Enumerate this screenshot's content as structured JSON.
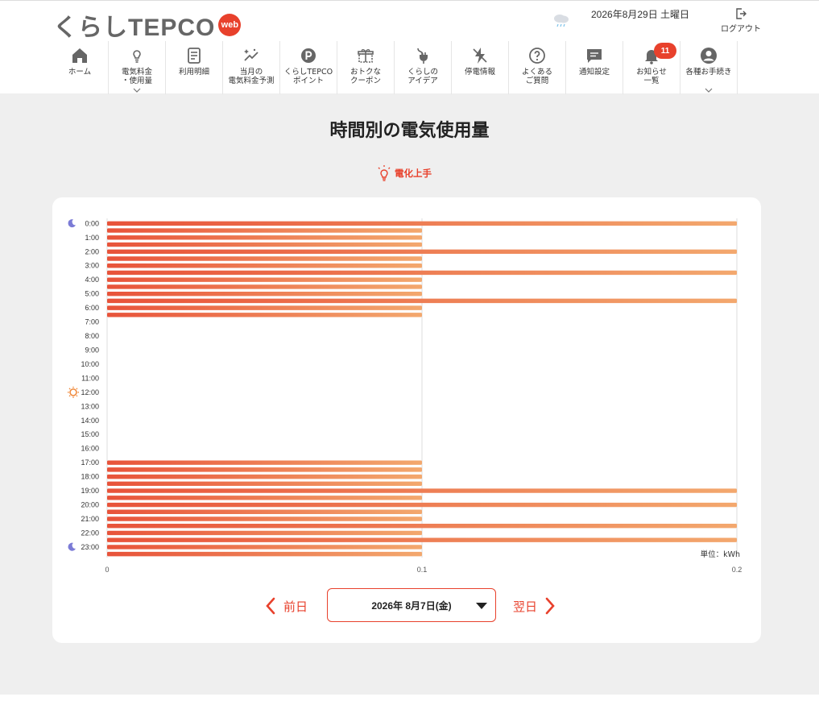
{
  "header": {
    "logo_main": "くらしTEPCO",
    "logo_badge": "web",
    "date": "2026年8月29日 土曜日",
    "logout_label": "ログアウト",
    "weather_icon": "cloud-rain-icon"
  },
  "nav": [
    {
      "id": "home",
      "label": "ホーム",
      "icon": "home-icon"
    },
    {
      "id": "usage",
      "label": "電気料金\n・使用量",
      "icon": "bulb-icon",
      "dropdown": true
    },
    {
      "id": "statement",
      "label": "利用明細",
      "icon": "document-icon"
    },
    {
      "id": "forecast",
      "label": "当月の\n電気料金予測",
      "icon": "sparkle-chart-icon"
    },
    {
      "id": "points",
      "label": "くらしTEPCO\nポイント",
      "icon": "point-icon"
    },
    {
      "id": "coupon",
      "label": "おトクな\nクーポン",
      "icon": "gift-icon"
    },
    {
      "id": "idea",
      "label": "くらしの\nアイデア",
      "icon": "plug-icon"
    },
    {
      "id": "outage",
      "label": "停電情報",
      "icon": "lightning-icon"
    },
    {
      "id": "faq",
      "label": "よくある\nご質問",
      "icon": "question-icon"
    },
    {
      "id": "notify-settings",
      "label": "通知設定",
      "icon": "chat-icon"
    },
    {
      "id": "notices",
      "label": "お知らせ\n一覧",
      "icon": "bell-icon",
      "badge": "11"
    },
    {
      "id": "procedures",
      "label": "各種お手続き",
      "icon": "user-icon",
      "dropdown": true
    }
  ],
  "main": {
    "title": "時間別の電気使用量",
    "denka_link": "電化上手"
  },
  "pager": {
    "prev_label": "前日",
    "next_label": "翌日",
    "selected_date": "2026年 8月7日(金)"
  },
  "colors": {
    "accent": "#e8412c",
    "bar_start": "#e8533a",
    "bar_end": "#f3a86e",
    "moon": "#7b7bd6",
    "sun": "#f08a3c"
  },
  "chart_data": {
    "type": "bar",
    "orientation": "horizontal",
    "unit_label": "単位：kWh",
    "xlim": [
      0,
      0.2
    ],
    "x_ticks": [
      "0",
      "0.1",
      "0.2"
    ],
    "hour_labels": [
      "0:00",
      "1:00",
      "2:00",
      "3:00",
      "4:00",
      "5:00",
      "6:00",
      "7:00",
      "8:00",
      "9:00",
      "10:00",
      "11:00",
      "12:00",
      "13:00",
      "14:00",
      "15:00",
      "16:00",
      "17:00",
      "18:00",
      "19:00",
      "20:00",
      "21:00",
      "22:00",
      "23:00"
    ],
    "interval": "30min",
    "values": [
      0.2,
      0.1,
      0.1,
      0.1,
      0.2,
      0.1,
      0.1,
      0.2,
      0.1,
      0.1,
      0.1,
      0.2,
      0.1,
      0.1,
      0.0,
      0.0,
      0.0,
      0.0,
      0.0,
      0.0,
      0.0,
      0.0,
      0.0,
      0.0,
      0.0,
      0.0,
      0.0,
      0.0,
      0.0,
      0.0,
      0.0,
      0.0,
      0.0,
      0.0,
      0.1,
      0.1,
      0.1,
      0.1,
      0.2,
      0.1,
      0.2,
      0.1,
      0.1,
      0.2,
      0.1,
      0.2,
      0.1,
      0.1
    ],
    "moon_hours": [
      "0:00",
      "23:00"
    ],
    "sun_hours": [
      "12:00"
    ]
  }
}
